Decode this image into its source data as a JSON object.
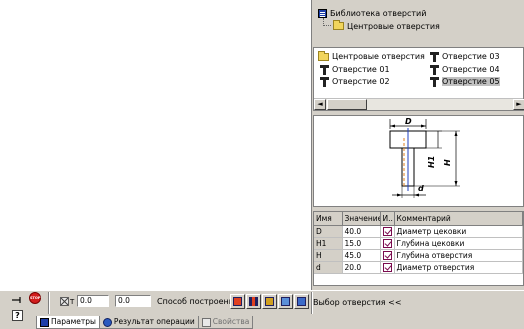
{
  "tree": {
    "root_label": "Библиотека отверстий",
    "child_label": "Центровые отверстия"
  },
  "list": {
    "items": [
      {
        "label": "Центровые отверстия",
        "icon": "folder-icon"
      },
      {
        "label": "Отверстие 01",
        "icon": "hole-icon"
      },
      {
        "label": "Отверстие 02",
        "icon": "hole-icon"
      },
      {
        "label": "Отверстие 03",
        "icon": "hole-icon"
      },
      {
        "label": "Отверстие 04",
        "icon": "hole-icon"
      },
      {
        "label": "Отверстие 05",
        "icon": "hole-icon",
        "selected": true
      }
    ],
    "scroll_left": "◄",
    "scroll_right": "►"
  },
  "preview": {
    "label_D": "D",
    "label_H1": "H1",
    "label_H": "H",
    "label_d": "d"
  },
  "table": {
    "headers": [
      "Имя",
      "Значение",
      "И..",
      "Комментарий"
    ],
    "rows": [
      {
        "name": "D",
        "value": "40.0",
        "checked": true,
        "comment": "Диаметр цековки"
      },
      {
        "name": "H1",
        "value": "15.0",
        "checked": true,
        "comment": "Глубина цековки"
      },
      {
        "name": "H",
        "value": "45.0",
        "checked": true,
        "comment": "Глубина отверстия"
      },
      {
        "name": "d",
        "value": "20.0",
        "checked": true,
        "comment": "Диаметр отверстия"
      }
    ]
  },
  "bottombar": {
    "coord_x_label": "T",
    "coord_x_value": "0.0",
    "coord_y_value": "0.0",
    "build_method_label": "Способ построения",
    "select_hole_label": "Выбор отверстия  <<",
    "tabs": [
      {
        "label": "Параметры",
        "active": true
      },
      {
        "label": "Результат операции",
        "active": false
      },
      {
        "label": "Свойства",
        "active": false,
        "dim": true
      }
    ]
  },
  "colors": {
    "panel": "#d4d0c8",
    "check": "#7a0b4e",
    "accent_blue": "#1c3ea8",
    "drawing_orange": "#e08020",
    "drawing_blue": "#2040c0"
  }
}
